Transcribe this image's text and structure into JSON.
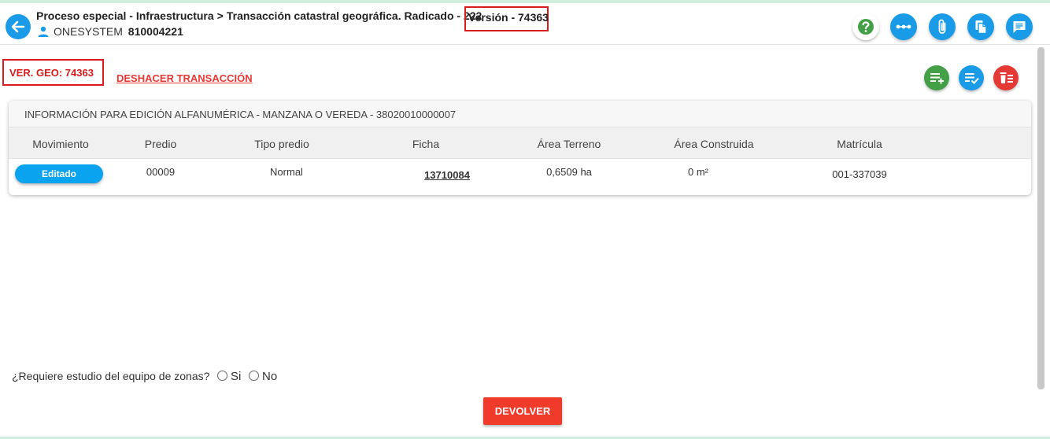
{
  "header": {
    "breadcrumb": {
      "parent": "Proceso especial - Infraestructura",
      "separator": ">",
      "current": "Transacción catastral geográfica. Radicado - 222",
      "version": "Versión - 74363"
    },
    "user": {
      "name": "ONESYSTEM",
      "id": "810004221"
    },
    "icons": [
      "help-icon",
      "more-horizontal-icon",
      "attachment-icon",
      "copy-document-icon",
      "comment-icon"
    ]
  },
  "actions": {
    "ver_geo": "VER. GEO: 74363",
    "undo_label": "DESHACER TRANSACCIÓN",
    "icons": [
      "add-to-list-icon",
      "checklist-icon",
      "delete-list-icon"
    ]
  },
  "card": {
    "title": "INFORMACIÓN PARA EDICIÓN ALFANUMÉRICA - MANZANA O VEREDA - 38020010000007",
    "columns": [
      "Movimiento",
      "Predio",
      "Tipo predio",
      "Ficha",
      "Área Terreno",
      "Área Construida",
      "Matrícula"
    ],
    "rows": [
      {
        "movimiento": "Editado",
        "predio": "00009",
        "tipo_predio": "Normal",
        "ficha": "13710084",
        "area_terreno": "0,6509 ha",
        "area_construida": "0 m²",
        "matricula": "001-337039"
      }
    ]
  },
  "question": {
    "label": "¿Requiere estudio del equipo de zonas?",
    "options": [
      "Si",
      "No"
    ],
    "selected": null
  },
  "footer": {
    "button_label": "DEVOLVER"
  },
  "colors": {
    "primary": "#1a9be8",
    "success": "#43a047",
    "danger": "#e53935",
    "highlight_border": "#d81b1b",
    "movement_badge": "#0aa3ef"
  }
}
